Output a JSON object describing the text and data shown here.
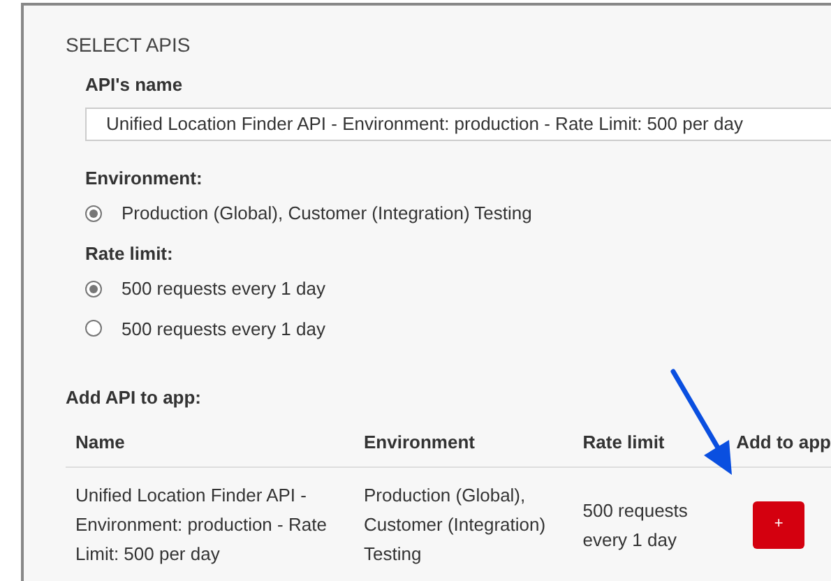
{
  "section_title": "SELECT APIS",
  "api_name": {
    "label": "API's name",
    "value": "Unified Location Finder API - Environment: production - Rate Limit: 500 per day"
  },
  "environment": {
    "label": "Environment:",
    "options": [
      {
        "label": "Production (Global), Customer (Integration) Testing",
        "selected": true
      }
    ]
  },
  "rate_limit": {
    "label": "Rate limit:",
    "options": [
      {
        "label": "500 requests every 1 day",
        "selected": true
      },
      {
        "label": "500 requests every 1 day",
        "selected": false
      }
    ]
  },
  "add_api": {
    "label": "Add API to app:",
    "columns": [
      "Name",
      "Environment",
      "Rate limit",
      "Add to app"
    ],
    "rows": [
      {
        "name": "Unified Location Finder API - Environment: production - Rate Limit: 500 per day",
        "environment": "Production (Global), Customer (Integration) Testing",
        "rate_limit": "500 requests every 1 day",
        "button": "+"
      }
    ]
  }
}
